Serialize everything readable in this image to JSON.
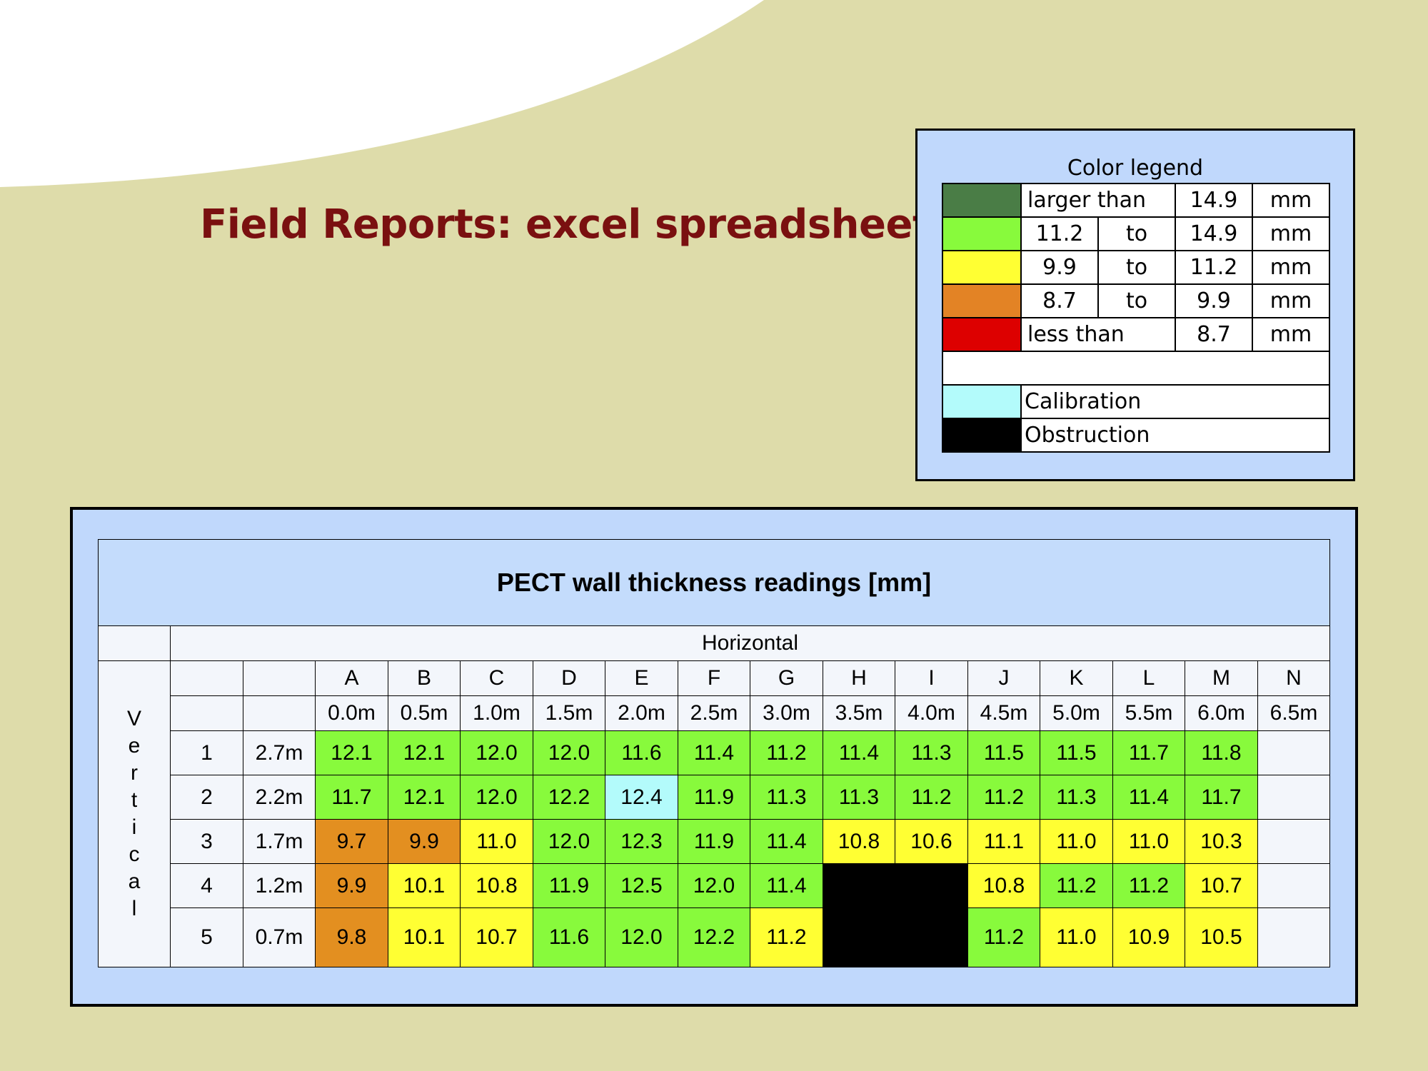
{
  "page": {
    "title": "Field Reports: excel spreadsheet",
    "background_color": "#dedcaa",
    "title_color": "#7a1010",
    "panel_color": "#c0d8fc"
  },
  "legend": {
    "title": "Color legend",
    "rows": [
      {
        "color": "#4a7d46",
        "cells": [
          "larger than",
          "14.9",
          "mm"
        ]
      },
      {
        "color": "#88fa3c",
        "cells": [
          "11.2",
          "to",
          "14.9",
          "mm"
        ]
      },
      {
        "color": "#ffff33",
        "cells": [
          "9.9",
          "to",
          "11.2",
          "mm"
        ]
      },
      {
        "color": "#e38325",
        "cells": [
          "8.7",
          "to",
          "9.9",
          "mm"
        ]
      },
      {
        "color": "#dd0000",
        "cells": [
          "less than",
          "8.7",
          "mm"
        ]
      }
    ],
    "special": [
      {
        "color": "#b3fbfb",
        "label": "Calibration"
      },
      {
        "color": "#000000",
        "label": "Obstruction"
      }
    ]
  },
  "table": {
    "title": "PECT wall thickness readings [mm]",
    "horizontal_label": "Horizontal",
    "vertical_label": "Vertical",
    "columns": [
      "A",
      "B",
      "C",
      "D",
      "E",
      "F",
      "G",
      "H",
      "I",
      "J",
      "K",
      "L",
      "M",
      "N"
    ],
    "positions": [
      "0.0m",
      "0.5m",
      "1.0m",
      "1.5m",
      "2.0m",
      "2.5m",
      "3.0m",
      "3.5m",
      "4.0m",
      "4.5m",
      "5.0m",
      "5.5m",
      "6.0m",
      "6.5m"
    ],
    "rows": [
      {
        "index": "1",
        "height": "2.7m",
        "values": [
          "12.1",
          "12.1",
          "12.0",
          "12.0",
          "11.6",
          "11.4",
          "11.2",
          "11.4",
          "11.3",
          "11.5",
          "11.5",
          "11.7",
          "11.8",
          ""
        ]
      },
      {
        "index": "2",
        "height": "2.2m",
        "values": [
          "11.7",
          "12.1",
          "12.0",
          "12.2",
          "12.4",
          "11.9",
          "11.3",
          "11.3",
          "11.2",
          "11.2",
          "11.3",
          "11.4",
          "11.7",
          ""
        ]
      },
      {
        "index": "3",
        "height": "1.7m",
        "values": [
          "9.7",
          "9.9",
          "11.0",
          "12.0",
          "12.3",
          "11.9",
          "11.4",
          "10.8",
          "10.6",
          "11.1",
          "11.0",
          "11.0",
          "10.3",
          ""
        ]
      },
      {
        "index": "4",
        "height": "1.2m",
        "values": [
          "9.9",
          "10.1",
          "10.8",
          "11.9",
          "12.5",
          "12.0",
          "11.4",
          "",
          "",
          "10.8",
          "11.2",
          "11.2",
          "10.7",
          ""
        ]
      },
      {
        "index": "5",
        "height": "0.7m",
        "values": [
          "9.8",
          "10.1",
          "10.7",
          "11.6",
          "12.0",
          "12.2",
          "11.2",
          "",
          "",
          "11.2",
          "11.0",
          "10.9",
          "10.5",
          ""
        ]
      }
    ],
    "cell_colors": [
      [
        "green",
        "green",
        "green",
        "green",
        "green",
        "green",
        "green",
        "green",
        "green",
        "green",
        "green",
        "green",
        "green",
        "white"
      ],
      [
        "green",
        "green",
        "green",
        "green",
        "cyan",
        "green",
        "green",
        "green",
        "green",
        "green",
        "green",
        "green",
        "green",
        "white"
      ],
      [
        "orange",
        "orange",
        "yellow",
        "green",
        "green",
        "green",
        "green",
        "yellow",
        "yellow",
        "yellow",
        "yellow",
        "yellow",
        "yellow",
        "white"
      ],
      [
        "orange",
        "yellow",
        "yellow",
        "green",
        "green",
        "green",
        "green",
        "black",
        "black",
        "yellow",
        "green",
        "green",
        "yellow",
        "white"
      ],
      [
        "orange",
        "yellow",
        "yellow",
        "green",
        "green",
        "green",
        "yellow",
        "black",
        "black",
        "green",
        "yellow",
        "yellow",
        "yellow",
        "white"
      ]
    ],
    "palette": {
      "green": "#88fa3c",
      "yellow": "#ffff33",
      "orange": "#e38f20",
      "cyan": "#b3fbfb",
      "black": "#000000",
      "white": "#f3f6fb"
    }
  }
}
